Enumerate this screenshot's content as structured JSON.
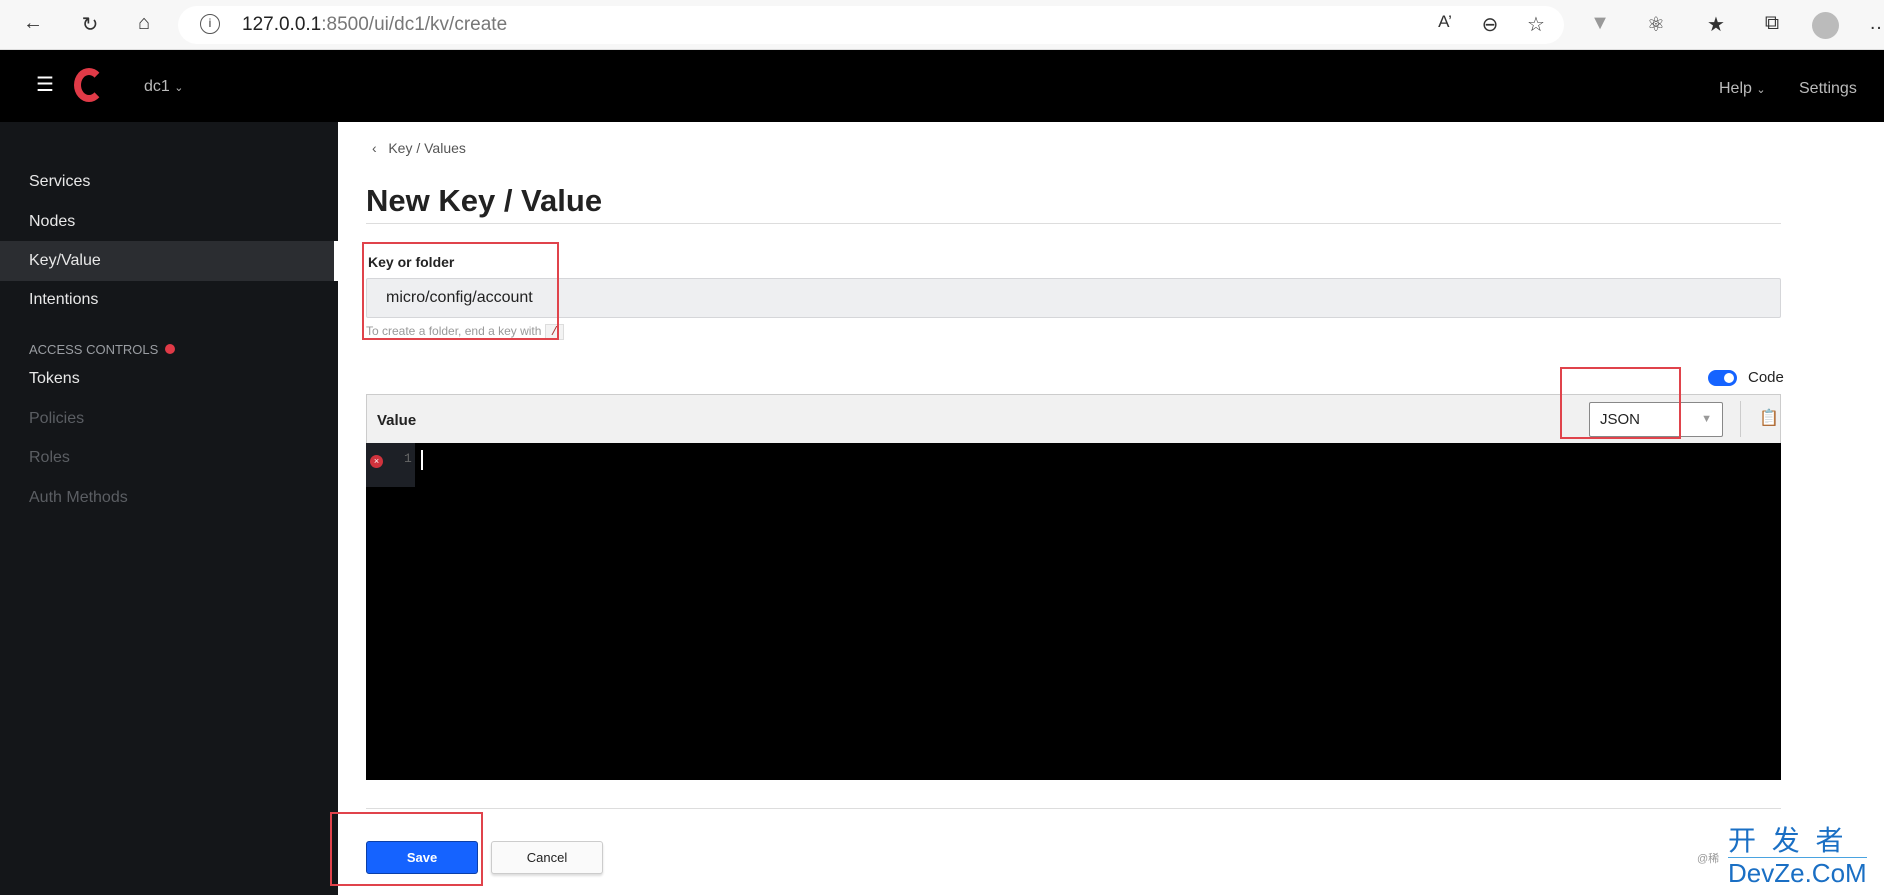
{
  "browser": {
    "url_host": "127.0.0.1",
    "url_rest": ":8500/ui/dc1/kv/create",
    "icons": [
      "back-icon",
      "refresh-icon",
      "home-icon",
      "info-icon",
      "read-aloud-icon",
      "zoom-out-icon",
      "add-favorite-icon",
      "extension-v-icon",
      "extensions-icon",
      "favorites-icon",
      "collections-icon",
      "profile-icon",
      "more-icon"
    ]
  },
  "header": {
    "datacenter": "dc1",
    "help": "Help",
    "settings": "Settings"
  },
  "sidebar": {
    "items": [
      {
        "label": "Services"
      },
      {
        "label": "Nodes"
      },
      {
        "label": "Key/Value"
      },
      {
        "label": "Intentions"
      }
    ],
    "section": "ACCESS CONTROLS",
    "acl_items": [
      {
        "label": "Tokens"
      },
      {
        "label": "Policies"
      },
      {
        "label": "Roles"
      },
      {
        "label": "Auth Methods"
      }
    ]
  },
  "main": {
    "breadcrumb": "Key / Values",
    "title": "New Key / Value",
    "key_label": "Key or folder",
    "key_value": "micro/config/account",
    "hint": "To create a folder, end a key with",
    "hint_code": "/",
    "code_toggle": "Code",
    "code_enabled": true,
    "value_label": "Value",
    "language": "JSON",
    "line_number": "1",
    "save": "Save",
    "cancel": "Cancel"
  },
  "colors": {
    "accent": "#1563ff",
    "highlight": "#e0434b",
    "brand": "#e03a47"
  },
  "watermark": {
    "line1": "开 发 者",
    "line2": "DevZe.CoM",
    "prefix": "@稀"
  }
}
